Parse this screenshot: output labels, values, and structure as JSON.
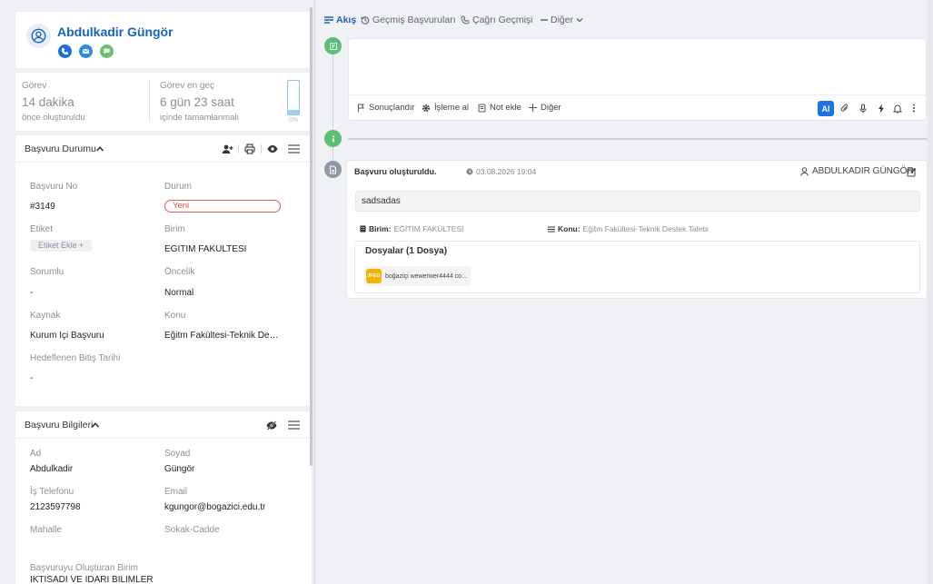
{
  "profile": {
    "name": "Abdulkadir Güngör",
    "actions": [
      {
        "icon": "phone-icon",
        "color": "#1b6fd8"
      },
      {
        "icon": "mail-icon",
        "color": "#2d8be0"
      },
      {
        "icon": "chat-icon",
        "color": "#6fbf6a"
      }
    ]
  },
  "stats": {
    "task": {
      "label": "Görev",
      "value": "14 dakika",
      "sub": "önce oluşturuldu"
    },
    "deadline": {
      "label": "Görev en geç",
      "value": "6 gün 23 saat",
      "sub": "içinde tamamlanmalı"
    },
    "progress": {
      "label": "0%",
      "fraction": 0.0
    }
  },
  "status_section": {
    "title": "Başvuru Durumu",
    "fields": {
      "no": {
        "label": "Başvuru No",
        "value": "#3149"
      },
      "durum": {
        "label": "Durum",
        "value": "Yeni"
      },
      "etiket": {
        "label": "Etiket",
        "value": "Etiket Ekle +"
      },
      "birim": {
        "label": "Birim",
        "value": "EĞİTİM FAKÜLTESİ"
      },
      "sorumlu": {
        "label": "Sorumlu",
        "value": "-"
      },
      "oncelik": {
        "label": "Öncelik",
        "value": "Normal"
      },
      "kaynak": {
        "label": "Kaynak",
        "value": "Kurum İçi Başvuru"
      },
      "konu": {
        "label": "Konu",
        "value": "Eğitm Fakültesi-Teknik Destek Talebi"
      },
      "bitis": {
        "label": "Hedeflenen Bitiş Tarihi",
        "value": "-"
      }
    }
  },
  "info_section": {
    "title": "Başvuru Bilgileri",
    "fields": {
      "ad": {
        "label": "Ad",
        "value": "Abdulkadir"
      },
      "soyad": {
        "label": "Soyad",
        "value": "Güngör"
      },
      "telefon": {
        "label": "İş Telefonu",
        "value": "2123597798"
      },
      "email": {
        "label": "Email",
        "value": "kgungor@bogazici.edu.tr"
      },
      "mahalle": {
        "label": "Mahalle",
        "value": ""
      },
      "sokak": {
        "label": "Sokak-Cadde",
        "value": ""
      },
      "olusturan": {
        "label": "Başvuruyu Oluşturan Birim",
        "value": "İKTİSADİ VE İDARİ BİLİMLER"
      }
    }
  },
  "tabs": [
    {
      "label": "Akış",
      "icon": "list-icon",
      "active": true
    },
    {
      "label": "Geçmiş Başvuruları",
      "icon": "history-icon",
      "active": false
    },
    {
      "label": "Çağrı Geçmişi",
      "icon": "phone-icon",
      "active": false
    },
    {
      "label": "Diğer",
      "icon": "more-icon",
      "active": false
    }
  ],
  "editor": {
    "actions": {
      "sonuc": "Sonuçlandır",
      "isleme": "İşleme al",
      "not": "Not ekle",
      "diger": "Diğer"
    },
    "ai_label": "AI"
  },
  "entry": {
    "title": "Başvuru oluşturuldu.",
    "date": "03.08.2026 19:04",
    "user": "ABDULKADIR GÜNGÖR",
    "message": "sadsadas",
    "birim_label": "Birim:",
    "birim_value": "EĞİTİM FAKÜLTESİ",
    "konu_label": "Konu:",
    "konu_value": "Eğitm Fakültesi-Teknik Destek Talebi",
    "files_title": "Dosyalar (1 Dosya)",
    "file_type": "JPEG",
    "file_name": "boğaziçi wewerwer4444 co..."
  },
  "colors": {
    "accent": "#1763c6",
    "timeline_green": "#5cbf72",
    "timeline_grey": "#8f98a5",
    "status_red": "#d94c4c"
  }
}
